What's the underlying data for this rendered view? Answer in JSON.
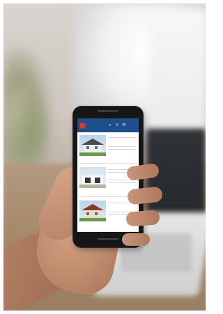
{
  "scene": {
    "description_tags": [
      "hand",
      "smartphone",
      "laptop",
      "window"
    ]
  },
  "app": {
    "header_icons": [
      "search-icon",
      "menu-icon",
      "mail-icon"
    ]
  },
  "colors": {
    "app_bar": "#1f4f8a",
    "logo": "#d23a2f",
    "listing_title": "#3377c0"
  }
}
